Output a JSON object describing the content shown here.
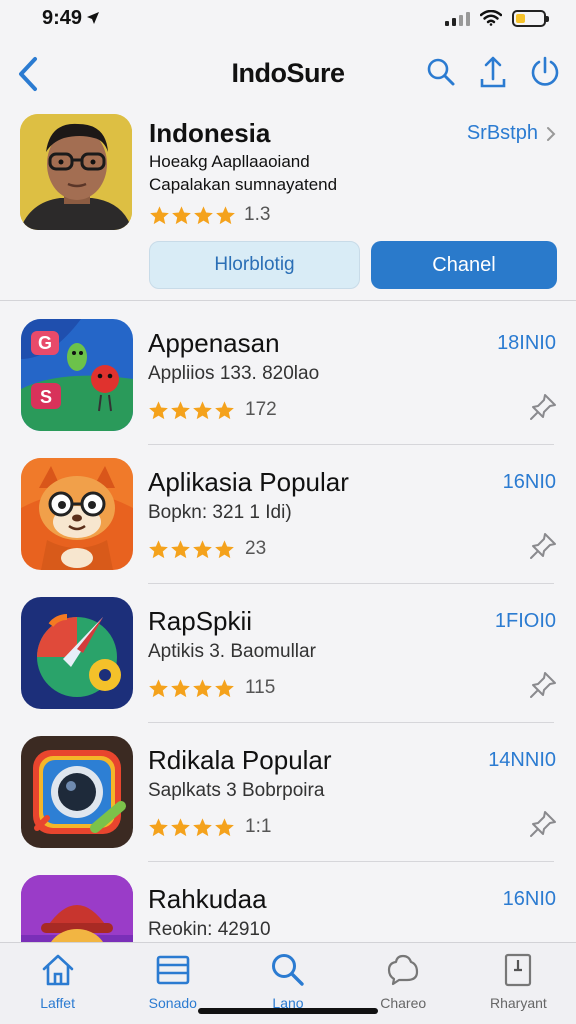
{
  "status": {
    "time": "9:49"
  },
  "nav": {
    "title": "IndoSure"
  },
  "featured": {
    "name": "Indonesia",
    "link": "SrBstph",
    "desc_line1": "Hoeakg Aapllaaoiand",
    "desc_line2": "Capalakan sumnayatend",
    "rating": "1.3",
    "secondary_button": "Hlorblotig",
    "primary_button": "Chanel"
  },
  "apps": [
    {
      "name": "Appenasan",
      "price": "18INI0",
      "subtitle": "Appliios 133. 820lao",
      "rating": "172"
    },
    {
      "name": "Aplikasia Popular",
      "price": "16NI0",
      "subtitle": "Bopkn: 321 1 Idi)",
      "rating": "23"
    },
    {
      "name": "RapSpkii",
      "price": "1FIOI0",
      "subtitle": "Aptikis 3. Baomullar",
      "rating": "115"
    },
    {
      "name": "Rdikala Popular",
      "price": "14NNI0",
      "subtitle": "Saplkats 3 Bobrpoira",
      "rating": "1:1"
    },
    {
      "name": "Rahkudaa",
      "price": "16NI0",
      "subtitle": "Reokin: 42910",
      "rating": ""
    }
  ],
  "tabs": [
    {
      "label": "Laffet",
      "icon": "home-icon"
    },
    {
      "label": "Sonado",
      "icon": "list-icon"
    },
    {
      "label": "Lano",
      "icon": "search-icon"
    },
    {
      "label": "Chareo",
      "icon": "chat-icon"
    },
    {
      "label": "Rharyant",
      "icon": "book-icon"
    }
  ],
  "colors": {
    "accent": "#2b7bd1",
    "star": "#f4a21c"
  }
}
